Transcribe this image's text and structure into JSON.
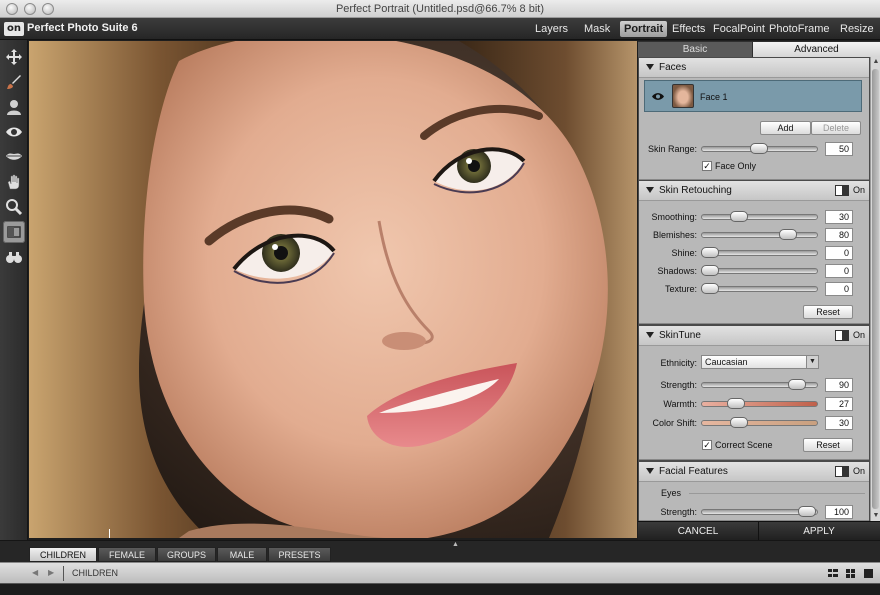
{
  "window": {
    "title": "Perfect Portrait (Untitled.psd@66.7% 8 bit)"
  },
  "app": {
    "logo": "on",
    "name": "Perfect Photo Suite 6"
  },
  "modules": [
    {
      "label": "Layers",
      "active": false
    },
    {
      "label": "Mask",
      "active": false
    },
    {
      "label": "Portrait",
      "active": true
    },
    {
      "label": "Effects",
      "active": false
    },
    {
      "label": "FocalPoint",
      "active": false
    },
    {
      "label": "PhotoFrame",
      "active": false
    },
    {
      "label": "Resize",
      "active": false
    }
  ],
  "tools": [
    {
      "icon": "move-icon",
      "selected": false
    },
    {
      "icon": "brush-icon",
      "selected": false
    },
    {
      "icon": "face-silhouette-icon",
      "selected": false
    },
    {
      "icon": "eye-icon",
      "selected": false
    },
    {
      "icon": "lips-icon",
      "selected": false
    },
    {
      "icon": "hand-icon",
      "selected": false
    },
    {
      "icon": "zoom-icon",
      "selected": false
    },
    {
      "icon": "compare-icon",
      "selected": true
    },
    {
      "icon": "binoculars-icon",
      "selected": false
    }
  ],
  "panel_tabs": {
    "basic": "Basic",
    "advanced": "Advanced",
    "active": "Advanced"
  },
  "faces": {
    "title": "Faces",
    "face_name": "Face 1",
    "add_label": "Add",
    "delete_label": "Delete",
    "skin_range_label": "Skin Range:",
    "skin_range_value": "50",
    "face_only_label": "Face Only",
    "face_only_checked": true
  },
  "skin_retouching": {
    "title": "Skin Retouching",
    "on_label": "On",
    "sliders": [
      {
        "label": "Smoothing:",
        "value": "30",
        "fraction": 0.3
      },
      {
        "label": "Blemishes:",
        "value": "80",
        "fraction": 0.8
      },
      {
        "label": "Shine:",
        "value": "0",
        "fraction": 0
      },
      {
        "label": "Shadows:",
        "value": "0",
        "fraction": 0
      },
      {
        "label": "Texture:",
        "value": "0",
        "fraction": 0
      }
    ],
    "reset_label": "Reset"
  },
  "skintune": {
    "title": "SkinTune",
    "on_label": "On",
    "ethnicity_label": "Ethnicity:",
    "ethnicity_value": "Caucasian",
    "strength_label": "Strength:",
    "strength_value": "90",
    "strength_fraction": 0.9,
    "warmth_label": "Warmth:",
    "warmth_value": "27",
    "warmth_fraction": 0.27,
    "color_shift_label": "Color Shift:",
    "color_shift_value": "30",
    "color_shift_fraction": 0.3,
    "correct_scene_label": "Correct Scene",
    "correct_scene_checked": true,
    "reset_label": "Reset",
    "warmth_color": "#c0604a",
    "color_shift_color": "#c9a07f"
  },
  "facial_features": {
    "title": "Facial Features",
    "on_label": "On",
    "subsection": "Eyes",
    "strength_label": "Strength:",
    "strength_value": "100",
    "strength_fraction": 1.0
  },
  "footer": {
    "cancel": "CANCEL",
    "apply": "APPLY"
  },
  "preset_tabs": [
    {
      "label": "CHILDREN",
      "active": true
    },
    {
      "label": "FEMALE",
      "active": false
    },
    {
      "label": "GROUPS",
      "active": false
    },
    {
      "label": "MALE",
      "active": false
    },
    {
      "label": "PRESETS",
      "active": false
    }
  ],
  "bottom_bar": {
    "current_category": "CHILDREN"
  },
  "colors": {
    "selected_face_row": "#7a9aaa",
    "active_module": "#b8b8b8"
  }
}
